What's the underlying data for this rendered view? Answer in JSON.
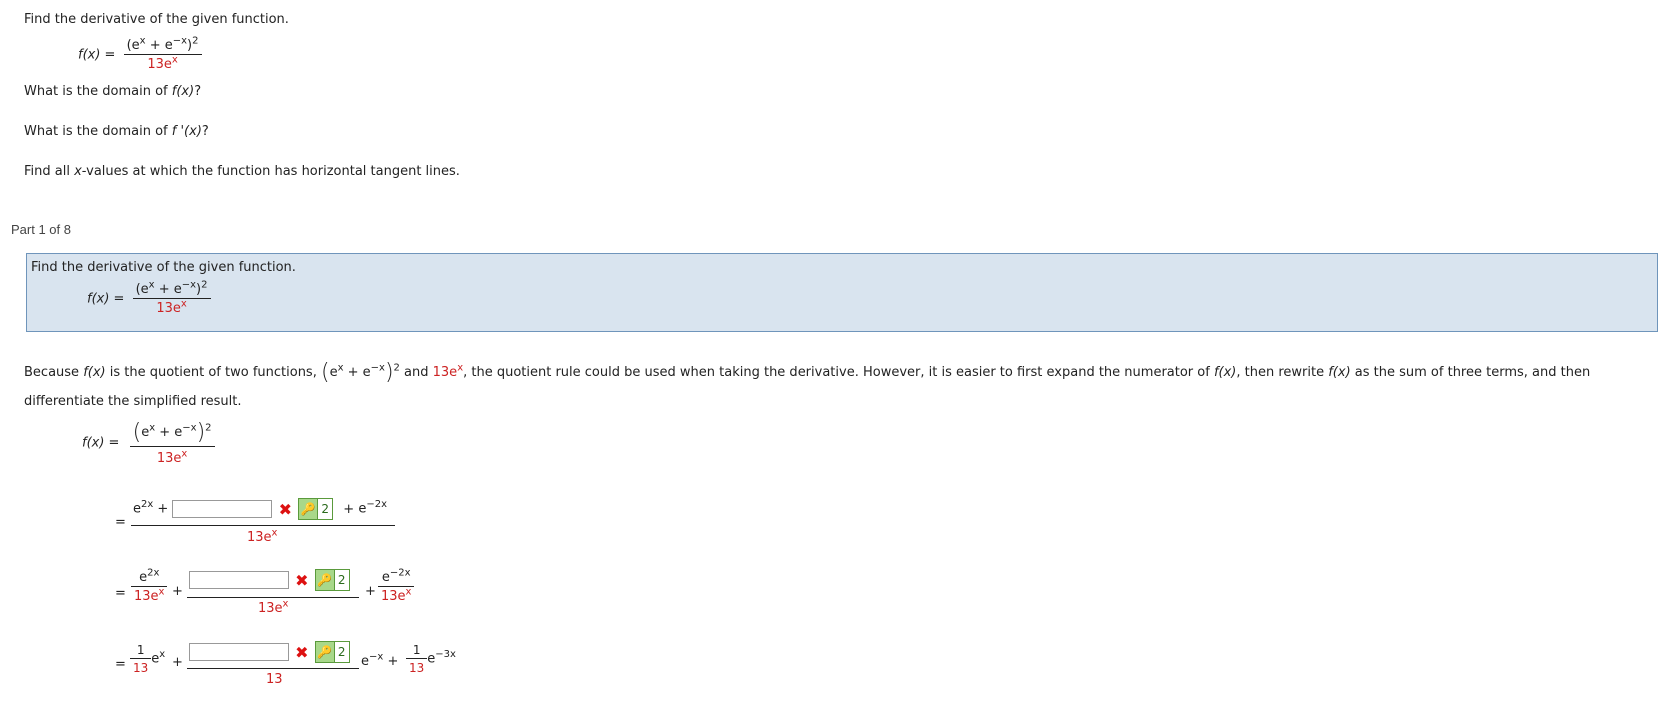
{
  "problem": {
    "title": "Find the derivative of the given function.",
    "f_label": "f(x) =",
    "num": "(e",
    "num_sup_x": "x",
    "num_mid": " + e",
    "num_sup_negx": "−x",
    "num_end": ")",
    "num_sup_2": "2",
    "den_coef": "13e",
    "den_sup": "x",
    "q_domain_f_pre": "What is the domain of ",
    "q_domain_f_fn": "f(x)",
    "q_domain_f_post": "?",
    "q_domain_fp_pre": "What is the domain of ",
    "q_domain_fp_fn": "f '(x)",
    "q_domain_fp_post": "?",
    "q_tangent_pre": "Find all ",
    "q_tangent_var": "x",
    "q_tangent_post": "-values at which the function has horizontal tangent lines."
  },
  "part": {
    "label": "Part 1 of 8"
  },
  "explain": {
    "line1_a": "Because ",
    "fx": "f(x)",
    "line1_b": " is the quotient of two functions, ",
    "line1_c": " and ",
    "thirteen_e": "13e",
    "sup_x": "x",
    "line1_d": ", the quotient rule could be used when taking the derivative. However, it is easier to first expand the numerator of ",
    "line1_e": ", then rewrite ",
    "line1_f": " as the sum of three terms, and then",
    "line2": "differentiate the simplified result."
  },
  "steps": {
    "eq": "=",
    "e": "e",
    "plus": "+",
    "sup_2x": "2x",
    "sup_neg2x": "−2x",
    "sup_negx": "−x",
    "sup_neg3x": "−3x",
    "thirteen": "13",
    "one": "1",
    "x_mark": "✖",
    "key_icon": "🔑",
    "attempts": "2"
  }
}
